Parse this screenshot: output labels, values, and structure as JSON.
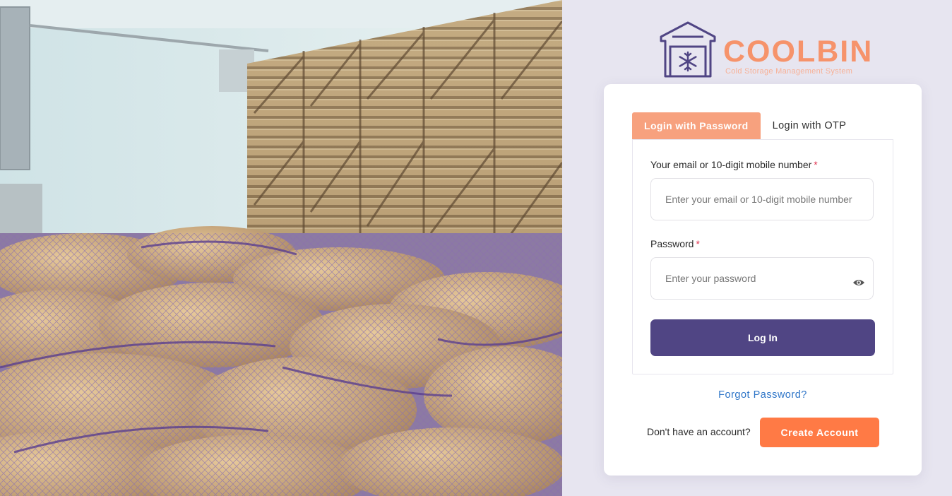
{
  "brand": {
    "name": "COOLBIN",
    "tagline": "Cold Storage Management System",
    "logo_icon": "warehouse-snowflake-icon",
    "colors": {
      "accent": "#f6936b",
      "primary": "#504584",
      "cta": "#ff7a45",
      "link": "#2f76c8"
    }
  },
  "hero": {
    "image_name": "warehouse-potato-sacks-photo"
  },
  "tabs": [
    {
      "label": "Login with Password",
      "active": true
    },
    {
      "label": "Login with OTP",
      "active": false
    }
  ],
  "form": {
    "email_label": "Your email or 10-digit mobile number",
    "email_placeholder": "Enter your email or 10-digit mobile number",
    "password_label": "Password",
    "password_placeholder": "Enter your password",
    "required_marker": "*",
    "toggle_icon": "eye-icon",
    "submit_label": "Log In"
  },
  "footer": {
    "forgot_label": "Forgot Password?",
    "signup_prompt": "Don't have an account?",
    "signup_label": "Create Account"
  }
}
